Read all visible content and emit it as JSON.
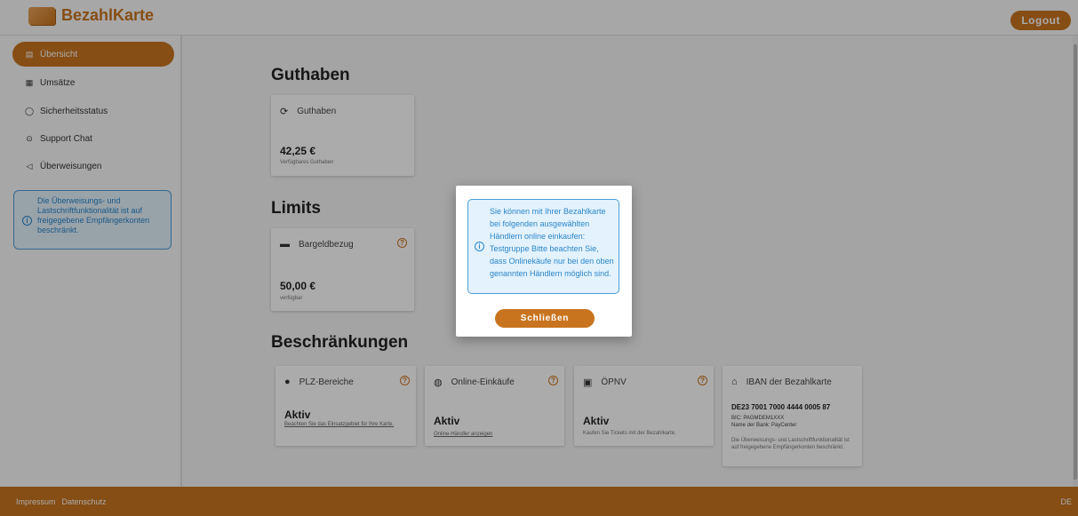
{
  "header": {
    "logo_text": "BezahlKarte",
    "logout_label": "Logout"
  },
  "sidebar": {
    "items": [
      {
        "label": "Übersicht",
        "icon": "▤"
      },
      {
        "label": "Umsätze",
        "icon": "▦"
      },
      {
        "label": "Sicherheitsstatus",
        "icon": "◯"
      },
      {
        "label": "Support Chat",
        "icon": "⊙"
      },
      {
        "label": "Überweisungen",
        "icon": "◁"
      }
    ],
    "info_text": "Die Überweisungs- und Lastschriftfunktionalität ist auf freigegebene Empfängerkonten beschränkt.",
    "info_icon": "i"
  },
  "guthaben": {
    "title": "Guthaben",
    "card_label": "Guthaben",
    "card_icon": "⟳",
    "value": "42,25 €",
    "sub": "Verfügbares Guthaben"
  },
  "limits": {
    "title": "Limits",
    "card_label": "Bargeldbezug",
    "card_icon": "▬",
    "value": "50,00 €",
    "sub": "verfügbar",
    "help_icon": "?"
  },
  "restrictions": {
    "title": "Beschränkungen",
    "plz": {
      "label": "PLZ-Bereiche",
      "icon": "●",
      "value": "Aktiv",
      "link": "Beachten Sie das Einsatzgebiet für Ihre Karte."
    },
    "online": {
      "label": "Online-Einkäufe",
      "icon": "◍",
      "value": "Aktiv",
      "link": "Online-Händler anzeigen"
    },
    "oepnv": {
      "label": "ÖPNV",
      "icon": "▣",
      "value": "Aktiv",
      "sub": "Kaufen Sie Tickets mit der Bezahlkarte."
    },
    "iban": {
      "label": "IBAN der Bezahlkarte",
      "icon": "⌂",
      "value": "DE23 7001 7000 4444 0005 87",
      "bic": "BIC: PAGMDEM1XXX",
      "bank": "Name der Bank: PayCenter",
      "note": "Die Überweisungs- und Lastschriftfunktionalität ist auf freigegebene Empfängerkonten beschränkt."
    }
  },
  "modal": {
    "text": "Sie können mit Ihrer Bezahlkarte bei folgenden ausgewählten Händlern online einkaufen: Testgruppe Bitte beachten Sie, dass Onlinekäufe nur bei den oben genannten Händlern möglich sind.",
    "close_label": "Schließen"
  },
  "footer": {
    "impressum": "Impressum",
    "datenschutz": "Datenschutz",
    "lang": "DE"
  },
  "colors": {
    "brand": "#c8741e",
    "info": "#2a86c9",
    "info_bg": "#e3f2fd"
  }
}
